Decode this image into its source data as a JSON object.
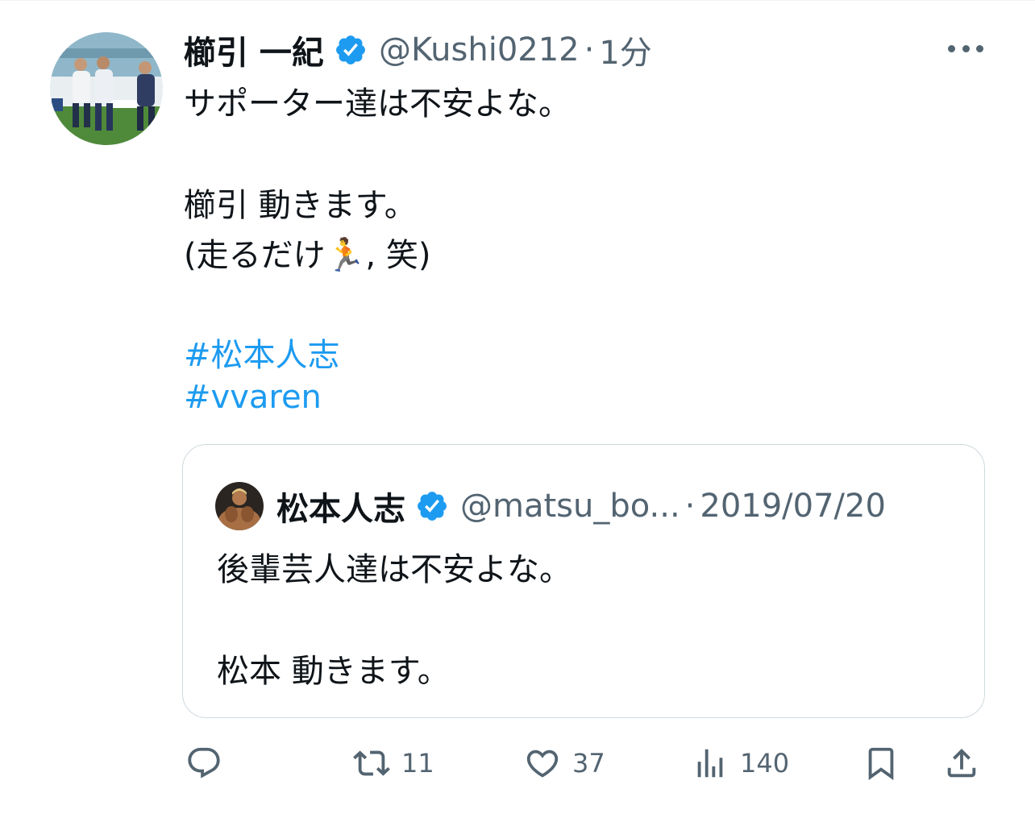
{
  "tweet": {
    "display_name": "櫛引 一紀",
    "handle": "@Kushi0212",
    "separator": "·",
    "time": "1分",
    "lines": [
      "サポーター達は不安よな。",
      "櫛引 動きます。",
      "(走るだけ🏃, 笑)"
    ],
    "hashtags": [
      "#松本人志",
      "#vvaren"
    ]
  },
  "quoted_tweet": {
    "display_name": "松本人志",
    "handle": "@matsu_bo...",
    "separator": "·",
    "date": "2019/07/20",
    "lines": [
      "後輩芸人達は不安よな。",
      "松本 動きます。"
    ]
  },
  "actions": {
    "reply": {
      "icon": "reply-icon",
      "count": ""
    },
    "retweet": {
      "icon": "retweet-icon",
      "count": "11"
    },
    "like": {
      "icon": "like-icon",
      "count": "37"
    },
    "views": {
      "icon": "views-icon",
      "count": "140"
    },
    "bookmark": {
      "icon": "bookmark-icon"
    },
    "share": {
      "icon": "share-icon"
    }
  },
  "colors": {
    "text": "#0f1419",
    "secondary": "#536471",
    "link": "#1d9bf0",
    "verified": "#1d9bf0",
    "border": "#cfd9de"
  }
}
